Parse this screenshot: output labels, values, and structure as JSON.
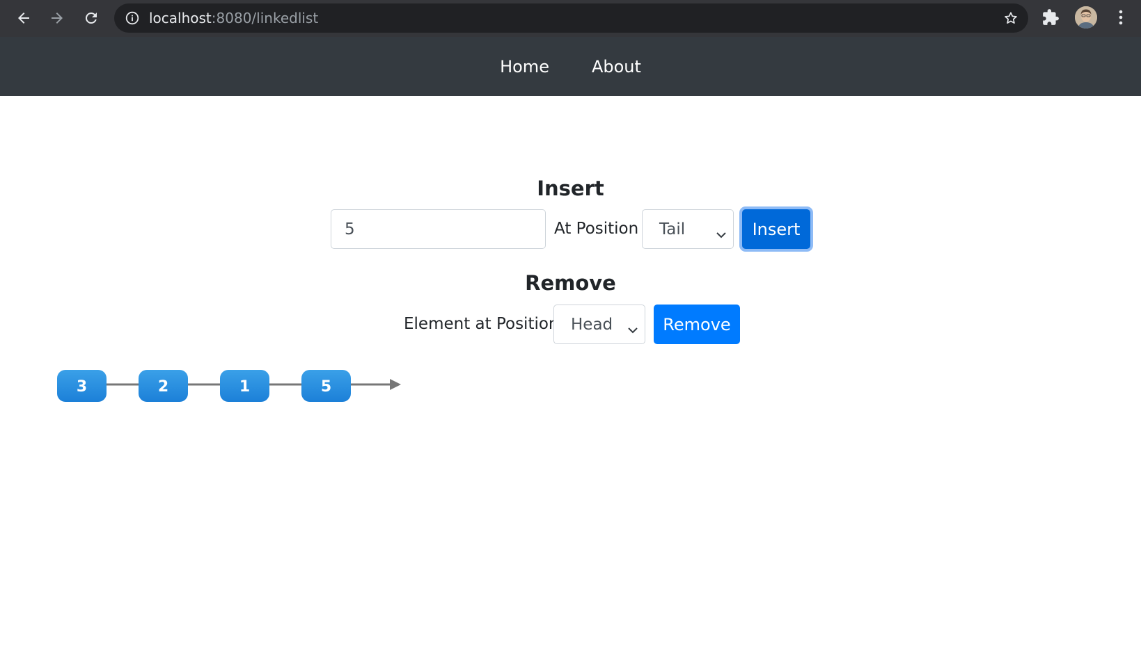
{
  "browser": {
    "url_host": "localhost",
    "url_path": ":8080/linkedlist",
    "icons": [
      "back-arrow-icon",
      "forward-arrow-icon",
      "reload-icon",
      "info-icon",
      "star-icon",
      "puzzle-icon",
      "avatar",
      "kebab-menu-icon"
    ]
  },
  "navbar": {
    "items": [
      {
        "label": "Home"
      },
      {
        "label": "About"
      }
    ]
  },
  "insert": {
    "title": "Insert",
    "value": "5",
    "position_label": "At Position",
    "position_selected": "Tail",
    "button_label": "Insert"
  },
  "remove": {
    "title": "Remove",
    "position_label": "Element at Position",
    "position_selected": "Head",
    "button_label": "Remove"
  },
  "linked_list": {
    "nodes": [
      "3",
      "2",
      "1",
      "5"
    ]
  },
  "colors": {
    "primary": "#007bff",
    "navbar": "#343a40",
    "node_top": "#3aa0e8",
    "node_bottom": "#1c80d8",
    "link": "#777777"
  }
}
